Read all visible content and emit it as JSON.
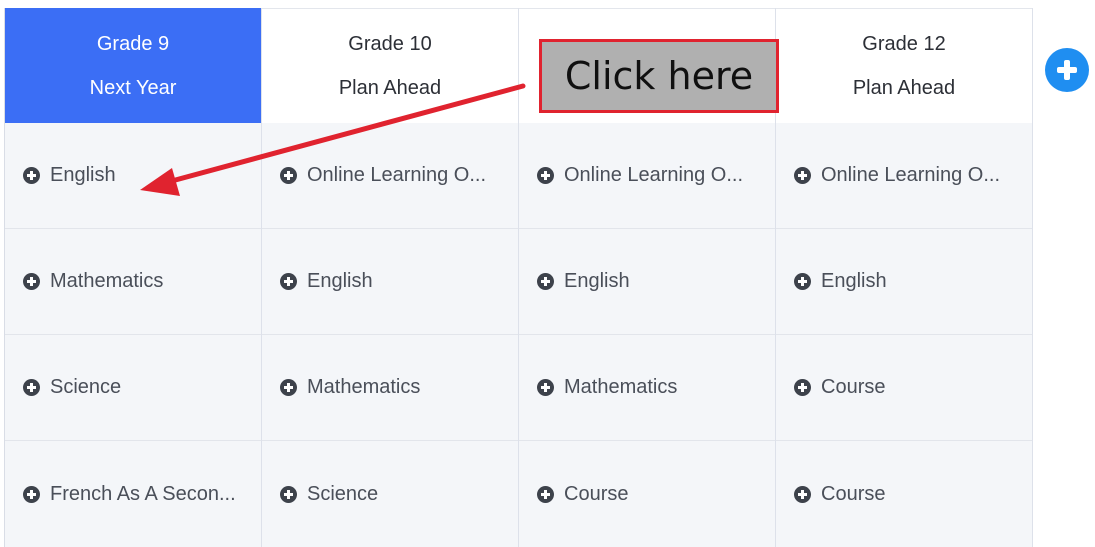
{
  "columns": [
    {
      "title": "Grade 9",
      "subtitle": "Next Year",
      "active": true,
      "items": [
        "English",
        "Mathematics",
        "Science",
        "French As A Secon..."
      ]
    },
    {
      "title": "Grade 10",
      "subtitle": "Plan Ahead",
      "active": false,
      "items": [
        "Online Learning O...",
        "English",
        "Mathematics",
        "Science"
      ]
    },
    {
      "title": "",
      "subtitle": "",
      "active": false,
      "items": [
        "Online Learning O...",
        "English",
        "Mathematics",
        "Course"
      ]
    },
    {
      "title": "Grade 12",
      "subtitle": "Plan Ahead",
      "active": false,
      "items": [
        "Online Learning O...",
        "English",
        "Course",
        "Course"
      ]
    }
  ],
  "callout": {
    "text": "Click here"
  },
  "colors": {
    "active_header": "#3b6ef5",
    "add_button": "#1f8ef1",
    "callout_border": "#e0232f",
    "callout_fill": "#b0b0b0",
    "arrow": "#e0232f"
  },
  "icons": {
    "item_add": "plus-circle-icon",
    "add_year": "plus-circle-icon"
  }
}
